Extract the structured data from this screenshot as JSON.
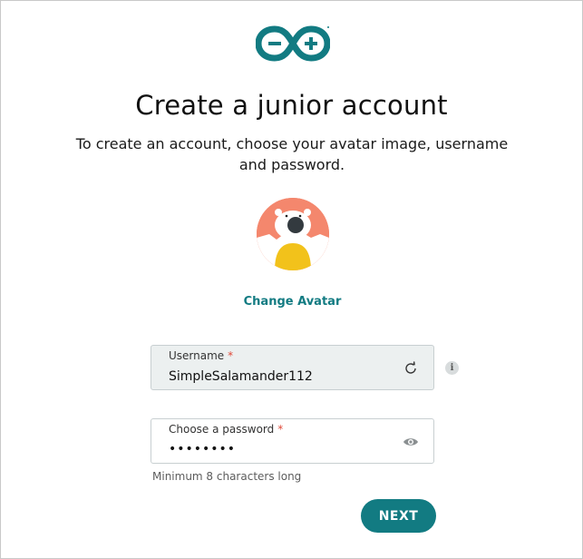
{
  "brand": {
    "logo_icon": "arduino-infinity-logo",
    "accent_color": "#127b82"
  },
  "page": {
    "title": "Create a junior account",
    "subtitle": "To create an account, choose your avatar image, username and password."
  },
  "avatar": {
    "icon": "polar-bear-avatar",
    "change_label": "Change Avatar"
  },
  "username": {
    "label": "Username",
    "required_marker": "*",
    "value": "SimpleSalamander112",
    "regenerate_icon": "refresh-icon",
    "info_icon": "info-icon",
    "info_glyph": "i"
  },
  "password": {
    "label": "Choose a password",
    "required_marker": "*",
    "value": "••••••••",
    "toggle_icon": "eye-icon",
    "hint": "Minimum 8 characters long"
  },
  "actions": {
    "next_label": "NEXT"
  }
}
